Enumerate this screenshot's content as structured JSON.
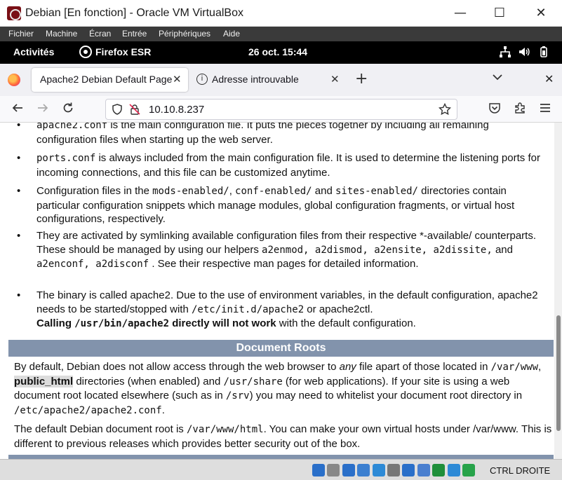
{
  "window": {
    "title": "Debian [En fonction] - Oracle VM VirtualBox",
    "minimize": "—",
    "maximize": "☐",
    "close": "✕"
  },
  "vbox_menu": [
    "Fichier",
    "Machine",
    "Écran",
    "Entrée",
    "Périphériques",
    "Aide"
  ],
  "gnome": {
    "activities": "Activités",
    "app": "Firefox ESR",
    "clock": "26 oct.  15:44"
  },
  "tabs": [
    {
      "label": "Apache2 Debian Default Page",
      "active": true
    },
    {
      "label": "Adresse introuvable",
      "active": false
    }
  ],
  "toolbar": {
    "url": "10.10.8.237",
    "new_tab": "+",
    "list_tabs": "⌄",
    "close_window": "✕"
  },
  "page": {
    "bullet1": {
      "parts": [
        "apache2.conf",
        " is the main configuration file. It puts the pieces together by including all remaining configuration files when starting up the web server."
      ]
    },
    "bullet2": {
      "code": "ports.conf",
      "text": " is always included from the main configuration file. It is used to determine the listening ports for incoming connections, and this file can be customized anytime."
    },
    "bullet3": {
      "t1": "Configuration files in the ",
      "c1": "mods-enabled/",
      "t2": ", ",
      "c2": "conf-enabled/",
      "t3": " and ",
      "c3": "sites-enabled/",
      "t4": " directories contain particular configuration snippets which manage modules, global configuration fragments, or virtual host configurations, respectively."
    },
    "bullet4": {
      "t1": "They are activated by symlinking available configuration files from their respective *-available/ counterparts. These should be managed by using our helpers ",
      "c1": "a2enmod, a2dismod, a2ensite, a2dissite,",
      "t2": " and ",
      "c2": "a2enconf, a2disconf",
      "t3": " . See their respective man pages for detailed information."
    },
    "bullet5": {
      "t1": "The binary is called apache2. Due to the use of environment variables, in the default configuration, apache2 needs to be started/stopped with ",
      "c1": "/etc/init.d/apache2",
      "t2": " or ",
      "c2": "apache2ctl",
      "t3": ".",
      "bold1": "Calling ",
      "bold_code": "/usr/bin/apache2",
      "bold2": " directly will not work",
      "t4": " with the default configuration."
    },
    "section_title": "Document Roots",
    "para1": {
      "t1": "By default, Debian does not allow access through the web browser to ",
      "em": "any",
      "t2": " file apart of those located in ",
      "c1": "/var/www",
      "t3": ", ",
      "hl": "public_html",
      "t4": " directories (when enabled) and ",
      "c2": "/usr/share",
      "t5": " (for web applications). If your site is using a web document root located elsewhere (such as in ",
      "c3": "/srv",
      "t6": ") you may need to whitelist your document root directory in ",
      "c4": "/etc/apache2/apache2.conf",
      "t7": "."
    },
    "para2": {
      "t1": "The default Debian document root is ",
      "c1": "/var/www/html",
      "t2": ". You can make your own virtual hosts under /var/www. This is different to previous releases which provides better security out of the box."
    }
  },
  "statusbar": {
    "hostkey": "CTRL DROITE",
    "icon_colors": [
      "#2a6fc9",
      "#888888",
      "#2a6fc9",
      "#3b7fd0",
      "#2d8ad6",
      "#777777",
      "#2a6fc9",
      "#4a7fcf",
      "#1f8f3a",
      "#2d8ad6",
      "#27a34a"
    ]
  }
}
